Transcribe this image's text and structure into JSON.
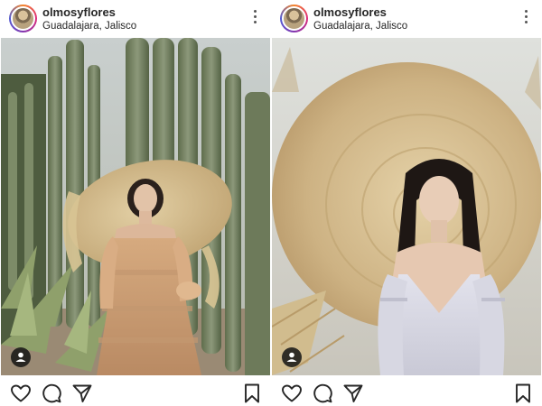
{
  "posts": [
    {
      "username": "olmosyflores",
      "location": "Guadalajara, Jalisco",
      "icons": {
        "more": "more-options-icon",
        "tag": "user-tag-icon",
        "like": "heart-icon",
        "comment": "comment-icon",
        "share": "share-icon",
        "save": "bookmark-icon"
      }
    },
    {
      "username": "olmosyflores",
      "location": "Guadalajara, Jalisco",
      "icons": {
        "more": "more-options-icon",
        "tag": "user-tag-icon",
        "like": "heart-icon",
        "comment": "comment-icon",
        "share": "share-icon",
        "save": "bookmark-icon"
      }
    }
  ],
  "colors": {
    "text": "#262626",
    "icon": "#262626",
    "background": "#ffffff"
  }
}
